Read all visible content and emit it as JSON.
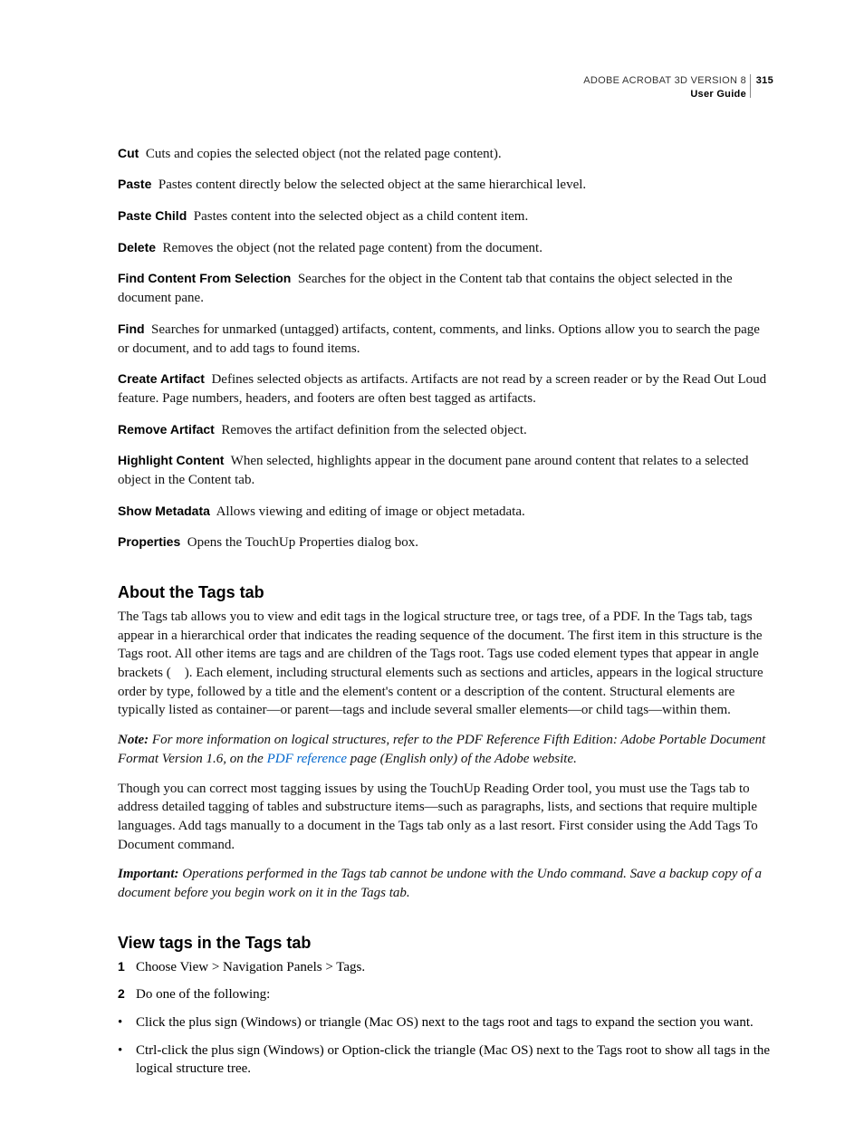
{
  "header": {
    "product": "ADOBE ACROBAT 3D VERSION 8",
    "doc": "User Guide",
    "page": "315"
  },
  "defs": [
    {
      "term": "Cut",
      "desc": "Cuts and copies the selected object (not the related page content)."
    },
    {
      "term": "Paste",
      "desc": "Pastes content directly below the selected object at the same hierarchical level."
    },
    {
      "term": "Paste Child",
      "desc": "Pastes content into the selected object as a child content item."
    },
    {
      "term": "Delete",
      "desc": "Removes the object (not the related page content) from the document."
    },
    {
      "term": "Find Content From Selection",
      "desc": "Searches for the object in the Content tab that contains the object selected in the document pane."
    },
    {
      "term": "Find",
      "desc": "Searches for unmarked (untagged) artifacts, content, comments, and links. Options allow you to search the page or document, and to add tags to found items."
    },
    {
      "term": "Create Artifact",
      "desc": "Defines selected objects as artifacts. Artifacts are not read by a screen reader or by the Read Out Loud feature. Page numbers, headers, and footers are often best tagged as artifacts."
    },
    {
      "term": "Remove Artifact",
      "desc": "Removes the artifact definition from the selected object."
    },
    {
      "term": "Highlight Content",
      "desc": "When selected, highlights appear in the document pane around content that relates to a selected object in the Content tab."
    },
    {
      "term": "Show Metadata",
      "desc": "Allows viewing and editing of image or object metadata."
    },
    {
      "term": "Properties",
      "desc": "Opens the TouchUp Properties dialog box."
    }
  ],
  "sec1": {
    "heading": "About the Tags tab",
    "p1": "The Tags tab allows you to view and edit tags in the logical structure tree, or tags tree, of a PDF. In the Tags tab, tags appear in a hierarchical order that indicates the reading sequence of the document. The first item in this structure is the Tags root. All other items are tags and are children of the Tags root. Tags use coded element types that appear in angle brackets (    ). Each element, including structural elements such as sections and articles, appears in the logical structure order by type, followed by a title and the element's content or a description of the content. Structural elements are typically listed as container—or parent—tags and include several smaller elements—or child tags—within them.",
    "note_lead": "Note:",
    "note_before": " For more information on logical structures, refer to the PDF Reference Fifth Edition: Adobe Portable Document Format Version 1.6, on the ",
    "note_link": "PDF reference",
    "note_after": " page (English only) of the Adobe website.",
    "p2": "Though you can correct most tagging issues by using the TouchUp Reading Order tool, you must use the Tags tab to address detailed tagging of tables and substructure items—such as paragraphs, lists, and sections that require multiple languages. Add tags manually to a document in the Tags tab only as a last resort. First consider using the Add Tags To Document command.",
    "imp_lead": "Important:",
    "imp_body": " Operations performed in the Tags tab cannot be undone with the Undo command. Save a backup copy of a document before you begin work on it in the Tags tab."
  },
  "sec2": {
    "heading": "View tags in the Tags tab",
    "steps": [
      "Choose View > Navigation Panels > Tags.",
      "Do one of the following:"
    ],
    "bullets": [
      "Click the plus sign (Windows) or triangle (Mac OS) next to the tags root and tags to expand the section you want.",
      "Ctrl-click the plus sign (Windows) or Option-click the triangle (Mac OS) next to the Tags root to show all tags in the logical structure tree."
    ]
  },
  "nums": [
    "1",
    "2"
  ],
  "dot": "•"
}
